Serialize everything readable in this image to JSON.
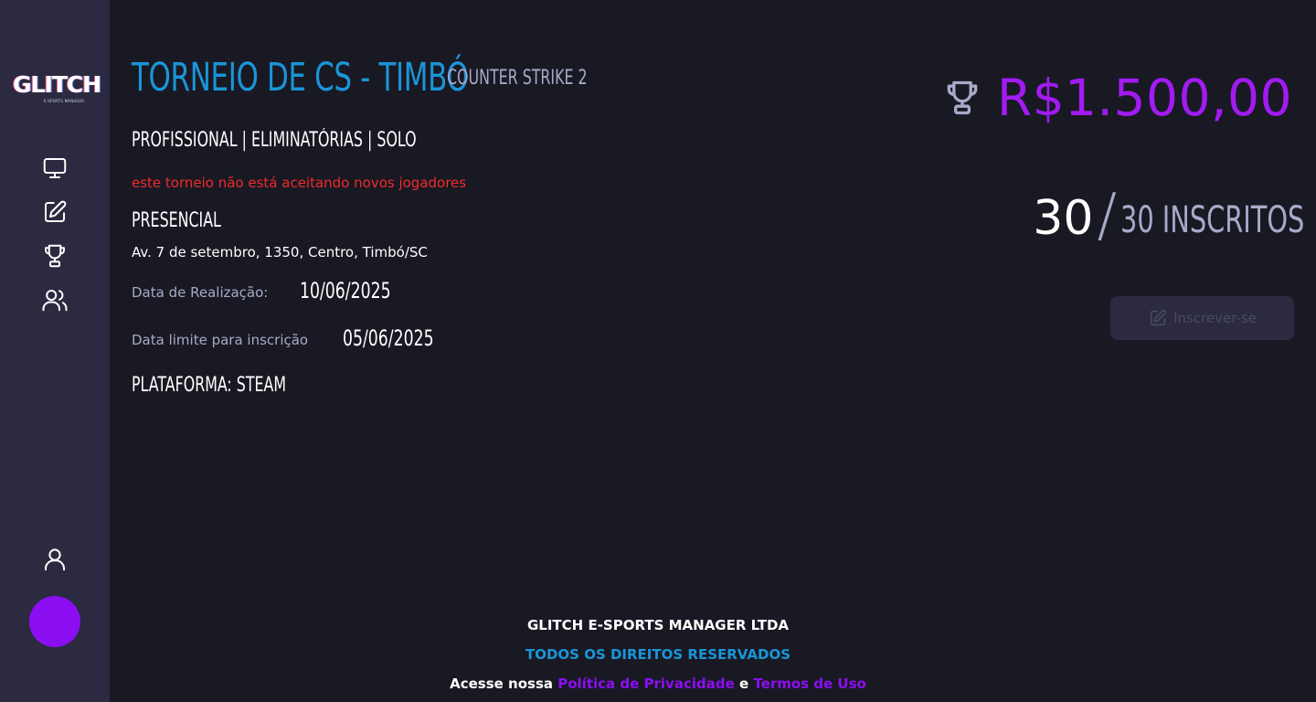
{
  "brand": {
    "logo_text": "GLITCH",
    "logo_subtext": "E-SPORTS MANAGER"
  },
  "sidebar": {
    "items": [
      {
        "icon": "monitor-icon"
      },
      {
        "icon": "edit-icon"
      },
      {
        "icon": "trophy-icon"
      },
      {
        "icon": "users-icon"
      }
    ],
    "bottom": [
      {
        "icon": "user-icon"
      },
      {
        "icon": "avatar"
      }
    ]
  },
  "tournament": {
    "title": "TORNEIO DE CS - TIMBÓ",
    "game": "COUNTER STRIKE 2",
    "tags": "PROFISSIONAL | ELIMINATÓRIAS | SOLO",
    "warning": "este torneio não está aceitando novos jogadores",
    "mode": "PRESENCIAL",
    "address": "Av. 7 de setembro, 1350, Centro, Timbó/SC",
    "date_label": "Data de Realização:",
    "date_value": "10/06/2025",
    "deadline_label": "Data limite para inscrição",
    "deadline_value": "05/06/2025",
    "platform": "PLATAFORMA: STEAM",
    "prize": "R$1.500,00",
    "registered": "30",
    "slash": "/",
    "capacity": "30 INSCRITOS",
    "enroll_label": "Inscrever-se"
  },
  "footer": {
    "company": "GLITCH E-SPORTS MANAGER LTDA",
    "rights": "TODOS OS DIREITOS RESERVADOS",
    "access_prefix": "Acesse nossa",
    "privacy": "Política de Privacidade",
    "and": "e",
    "terms": "Termos de Uso"
  },
  "colors": {
    "background": "#191923",
    "sidebar": "#2b2a40",
    "accent_blue": "#1a95d8",
    "accent_purple": "#a11bf2",
    "warning_red": "#f02a2a",
    "muted": "#a9a9c9"
  }
}
